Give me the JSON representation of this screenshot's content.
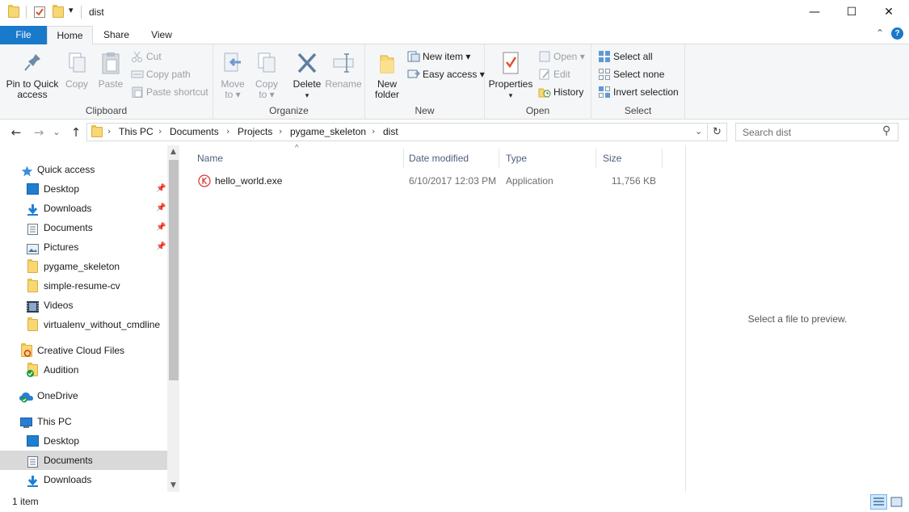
{
  "window": {
    "title": "dist",
    "minimize_glyph": "—",
    "maximize_glyph": "☐",
    "close_glyph": "✕",
    "qat_dropdown_glyph": "▾"
  },
  "ribbon_tabs": [
    {
      "label": "File"
    },
    {
      "label": "Home"
    },
    {
      "label": "Share"
    },
    {
      "label": "View"
    }
  ],
  "ribbon": {
    "collapse_glyph": "⌃",
    "help_glyph": "?",
    "clipboard": {
      "label": "Clipboard",
      "pin_line1": "Pin to Quick",
      "pin_line2": "access",
      "copy": "Copy",
      "paste": "Paste",
      "cut": "Cut",
      "copy_path": "Copy path",
      "paste_shortcut": "Paste shortcut"
    },
    "organize": {
      "label": "Organize",
      "move_to_line1": "Move",
      "move_to_line2": "to ▾",
      "copy_to_line1": "Copy",
      "copy_to_line2": "to ▾",
      "delete_line1": "Delete",
      "delete_line2": "▾",
      "rename": "Rename"
    },
    "new": {
      "label": "New",
      "new_folder_line1": "New",
      "new_folder_line2": "folder",
      "new_item": "New item ▾",
      "easy_access": "Easy access ▾"
    },
    "open": {
      "label": "Open",
      "properties": "Properties",
      "properties_arrow": "▾",
      "open": "Open ▾",
      "edit": "Edit",
      "history": "History"
    },
    "select": {
      "label": "Select",
      "select_all": "Select all",
      "select_none": "Select none",
      "invert_selection": "Invert selection"
    }
  },
  "address": {
    "back_glyph": "←",
    "forward_glyph": "→",
    "recent_glyph": "⌄",
    "up_glyph": "↑",
    "crumb_sep": "›",
    "breadcrumbs": [
      "This PC",
      "Documents",
      "Projects",
      "pygame_skeleton",
      "dist"
    ],
    "dropdown_glyph": "⌄",
    "refresh_glyph": "↻",
    "search_placeholder": "Search dist",
    "search_glyph": "⚲"
  },
  "nav_pane": {
    "pin_glyph": "📌",
    "scroll_up_glyph": "▲",
    "scroll_down_glyph": "▼",
    "items": [
      {
        "label": "Quick access",
        "icon": "star-icon"
      },
      {
        "label": "Desktop",
        "icon": "desktop-icon",
        "pinned": true
      },
      {
        "label": "Downloads",
        "icon": "download-icon",
        "pinned": true
      },
      {
        "label": "Documents",
        "icon": "documents-icon",
        "pinned": true
      },
      {
        "label": "Pictures",
        "icon": "pictures-icon",
        "pinned": true
      },
      {
        "label": "pygame_skeleton",
        "icon": "folder-icon"
      },
      {
        "label": "simple-resume-cv",
        "icon": "folder-icon"
      },
      {
        "label": "Videos",
        "icon": "videos-icon"
      },
      {
        "label": "virtualenv_without_cmdline",
        "icon": "folder-icon"
      },
      {
        "label": "Creative Cloud Files",
        "icon": "creative-cloud-icon"
      },
      {
        "label": "Audition",
        "icon": "folder-check-icon"
      },
      {
        "label": "OneDrive",
        "icon": "onedrive-icon"
      },
      {
        "label": "This PC",
        "icon": "computer-icon"
      },
      {
        "label": "Desktop",
        "icon": "desktop-icon"
      },
      {
        "label": "Documents",
        "icon": "documents-icon",
        "selected": true
      },
      {
        "label": "Downloads",
        "icon": "download-icon"
      }
    ]
  },
  "file_list": {
    "sort_glyph": "^",
    "columns": {
      "name": "Name",
      "date_modified": "Date modified",
      "type": "Type",
      "size": "Size"
    },
    "rows": [
      {
        "name": "hello_world.exe",
        "date_modified": "6/10/2017 12:03 PM",
        "type": "Application",
        "size": "11,756 KB",
        "icon": "app-k-icon"
      }
    ]
  },
  "preview": {
    "message": "Select a file to preview."
  },
  "status": {
    "item_count": "1 item"
  },
  "colors": {
    "file_tab": "#1979ca",
    "selection": "#d9d9d9",
    "column_header_text": "#4c607a"
  }
}
